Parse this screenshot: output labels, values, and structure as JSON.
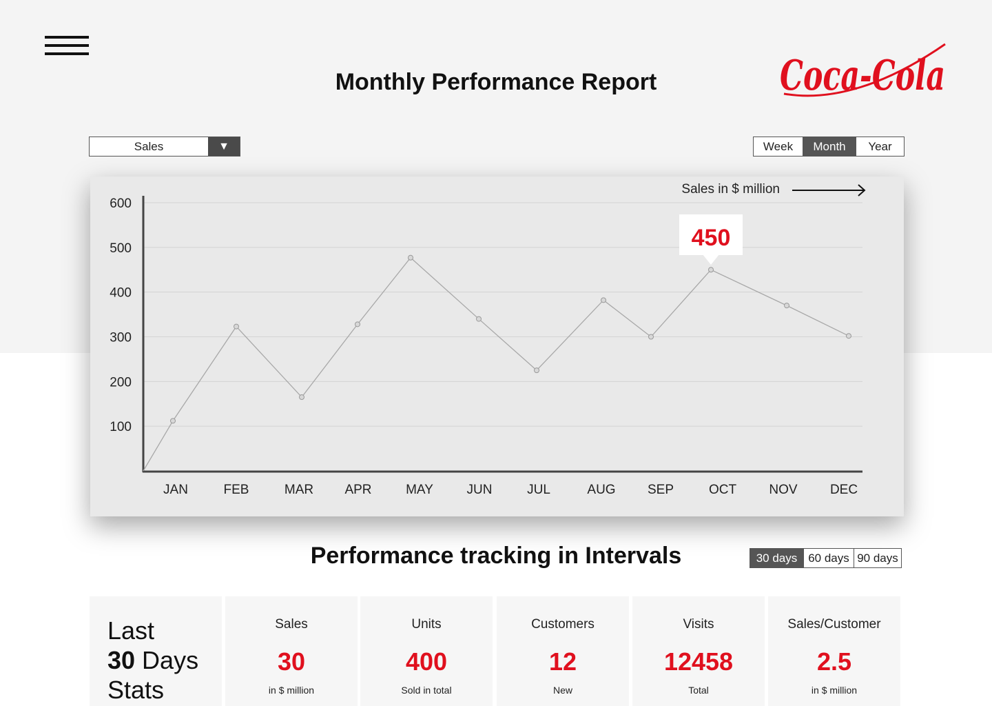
{
  "header": {
    "title": "Monthly Performance Report",
    "logo_text": "Coca-Cola",
    "brand_color": "#e0101e"
  },
  "controls": {
    "metric_select": {
      "value": "Sales",
      "options_icon": "triangle-down-icon"
    },
    "period_tabs": [
      {
        "label": "Week",
        "active": false
      },
      {
        "label": "Month",
        "active": true
      },
      {
        "label": "Year",
        "active": false
      }
    ]
  },
  "chart_data": {
    "type": "line",
    "categories": [
      "JAN",
      "FEB",
      "MAR",
      "APR",
      "MAY",
      "JUN",
      "JUL",
      "AUG",
      "SEP",
      "OCT",
      "NOV",
      "DEC"
    ],
    "values": [
      112,
      323,
      165,
      328,
      477,
      340,
      225,
      382,
      300,
      450,
      370,
      302
    ],
    "ylim": [
      0,
      600
    ],
    "yticks": [
      100,
      200,
      300,
      400,
      500,
      600
    ],
    "unit_label": "Sales in $ million",
    "highlight": {
      "category": "OCT",
      "label": "450"
    },
    "grid": true
  },
  "intervals": {
    "title": "Performance tracking in Intervals",
    "tabs": [
      {
        "label": "30 days",
        "active": true
      },
      {
        "label": "60 days",
        "active": false
      },
      {
        "label": "90 days",
        "active": false
      }
    ]
  },
  "stats": {
    "intro": {
      "line1": "Last",
      "bold": "30",
      "line2_rest": " Days",
      "line3": "Stats"
    },
    "cards": [
      {
        "label": "Sales",
        "value": "30",
        "sub": "in $ million"
      },
      {
        "label": "Units",
        "value": "400",
        "sub": "Sold in total"
      },
      {
        "label": "Customers",
        "value": "12",
        "sub": "New"
      },
      {
        "label": "Visits",
        "value": "12458",
        "sub": "Total"
      },
      {
        "label": "Sales/Customer",
        "value": "2.5",
        "sub": "in $ million"
      }
    ]
  }
}
